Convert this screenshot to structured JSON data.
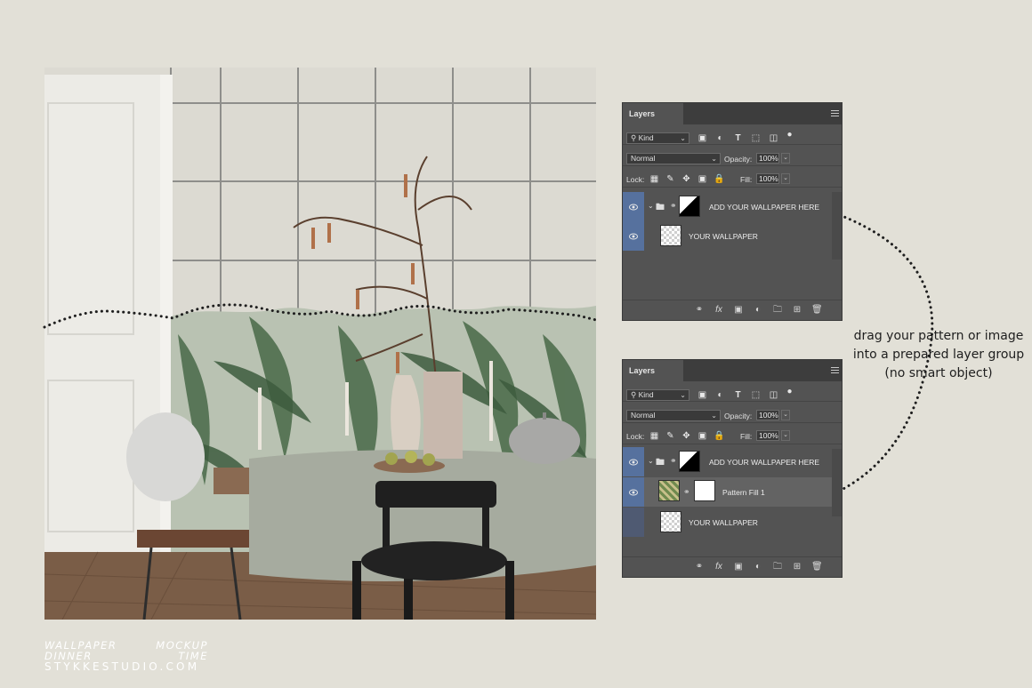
{
  "brand": {
    "line1_left": "WALLPAPER",
    "line1_right": "MOCKUP",
    "line2_left": "DINNER",
    "line2_right": "TIME",
    "site": "STYKKESTUDIO.COM"
  },
  "caption": {
    "line1": "drag your pattern or image",
    "line2": "into a prepared layer group",
    "line3": "(no smart object)"
  },
  "panels": [
    {
      "tab": "Layers",
      "kind": "Kind",
      "blend_mode": "Normal",
      "opacity_label": "Opacity:",
      "opacity": "100%",
      "lock_label": "Lock:",
      "fill_label": "Fill:",
      "fill": "100%",
      "layers": [
        {
          "name": "ADD YOUR WALLPAPER HERE",
          "visible": true,
          "type": "group"
        },
        {
          "name": "YOUR WALLPAPER",
          "visible": true,
          "type": "layer"
        }
      ]
    },
    {
      "tab": "Layers",
      "kind": "Kind",
      "blend_mode": "Normal",
      "opacity_label": "Opacity:",
      "opacity": "100%",
      "lock_label": "Lock:",
      "fill_label": "Fill:",
      "fill": "100%",
      "layers": [
        {
          "name": "ADD YOUR WALLPAPER HERE",
          "visible": true,
          "type": "group"
        },
        {
          "name": "Pattern Fill 1",
          "visible": true,
          "type": "fill",
          "selected": true
        },
        {
          "name": "YOUR WALLPAPER",
          "visible": false,
          "type": "layer"
        }
      ]
    }
  ],
  "icons": {
    "filter": [
      "image-filter-icon",
      "adjustment-filter-icon",
      "type-filter-icon",
      "shape-filter-icon",
      "smart-object-filter-icon",
      "filter-toggle-icon"
    ],
    "lock": [
      "lock-transparent-icon",
      "lock-pixels-icon",
      "lock-position-icon",
      "lock-artboard-icon",
      "lock-all-icon"
    ],
    "bottom": [
      "link-layers-icon",
      "fx-icon",
      "mask-icon",
      "adjustment-layer-icon",
      "new-group-icon",
      "new-layer-icon",
      "delete-layer-icon"
    ]
  },
  "colors": {
    "background": "#e2e0d7",
    "panel": "#535353",
    "visibility_cell": "#56719e"
  }
}
